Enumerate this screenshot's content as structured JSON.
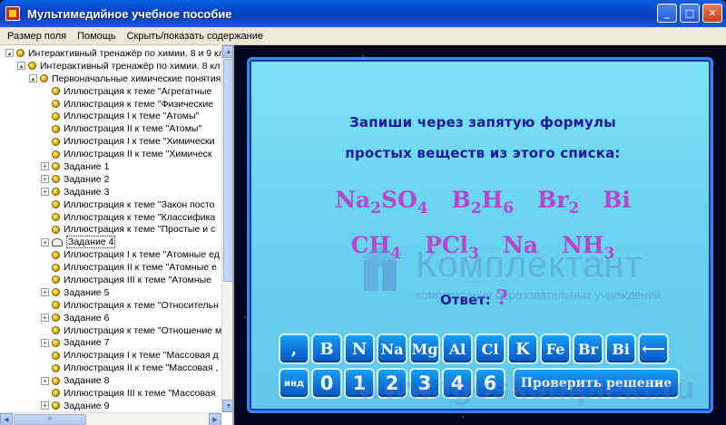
{
  "window": {
    "title": "Мультимедийное учебное пособие",
    "controls": {
      "minimize": "_",
      "maximize": "□",
      "close": "✕"
    }
  },
  "menu": {
    "items": [
      "Размер поля",
      "Помощь",
      "Скрыть/показать содержание"
    ]
  },
  "tree": {
    "items": [
      {
        "level": 0,
        "expander": "open",
        "label": "Интерактивный тренажёр по химии. 8 и 9 кл"
      },
      {
        "level": 1,
        "expander": "open",
        "label": "Интерактивный тренажёр по химии. 8 кл"
      },
      {
        "level": 2,
        "expander": "open",
        "label": "Первоначальные химические понятия"
      },
      {
        "level": 3,
        "expander": "none",
        "label": "Иллюстрация к теме \"Агрегатные"
      },
      {
        "level": 3,
        "expander": "none",
        "label": "Иллюстрация к теме \"Физические"
      },
      {
        "level": 3,
        "expander": "none",
        "label": "Иллюстрация I к теме \"Атомы\""
      },
      {
        "level": 3,
        "expander": "none",
        "label": "Иллюстрация II к теме \"Атомы\""
      },
      {
        "level": 3,
        "expander": "none",
        "label": "Иллюстрация I к теме \"Химически"
      },
      {
        "level": 3,
        "expander": "none",
        "label": "Иллюстрация II к теме \"Химическ"
      },
      {
        "level": 3,
        "expander": "closed",
        "label": "Задание 1"
      },
      {
        "level": 3,
        "expander": "closed",
        "label": "Задание 2"
      },
      {
        "level": 3,
        "expander": "closed",
        "label": "Задание 3"
      },
      {
        "level": 3,
        "expander": "none",
        "label": "Иллюстрация к теме \"Закон посто"
      },
      {
        "level": 3,
        "expander": "none",
        "label": "Иллюстрация к теме \"Классифика"
      },
      {
        "level": 3,
        "expander": "none",
        "label": "Иллюстрация к теме \"Простые и с"
      },
      {
        "level": 3,
        "expander": "closed",
        "label": "Задание 4",
        "selected": true,
        "icon": "open-book"
      },
      {
        "level": 3,
        "expander": "none",
        "label": "Иллюстрация I к теме \"Атомные ед"
      },
      {
        "level": 3,
        "expander": "none",
        "label": "Иллюстрация II к теме \"Атомные е"
      },
      {
        "level": 3,
        "expander": "none",
        "label": "Иллюстрация III к теме \"Атомные"
      },
      {
        "level": 3,
        "expander": "closed",
        "label": "Задание 5"
      },
      {
        "level": 3,
        "expander": "none",
        "label": "Иллюстрация к теме \"Относительн"
      },
      {
        "level": 3,
        "expander": "closed",
        "label": "Задание 6"
      },
      {
        "level": 3,
        "expander": "none",
        "label": "Иллюстрация к теме \"Отношение м"
      },
      {
        "level": 3,
        "expander": "closed",
        "label": "Задание 7"
      },
      {
        "level": 3,
        "expander": "none",
        "label": "Иллюстрация I к теме \"Массовая д"
      },
      {
        "level": 3,
        "expander": "none",
        "label": "Иллюстрация II к теме \"Массовая ,"
      },
      {
        "level": 3,
        "expander": "closed",
        "label": "Задание 8"
      },
      {
        "level": 3,
        "expander": "none",
        "label": "Иллюстрация III к теме \"Массовая"
      },
      {
        "level": 3,
        "expander": "closed",
        "label": "Задание 9"
      }
    ],
    "hscroll_grip": "III"
  },
  "task": {
    "line1": "Запиши через запятую формулы",
    "line2": "простых веществ из этого списка:",
    "formulas_row1": [
      {
        "parts": [
          [
            "Na",
            ""
          ],
          [
            "2",
            "sub"
          ],
          [
            "SO",
            ""
          ],
          [
            "4",
            "sub"
          ]
        ]
      },
      {
        "parts": [
          [
            "B",
            ""
          ],
          [
            "2",
            "sub"
          ],
          [
            "H",
            ""
          ],
          [
            "6",
            "sub"
          ]
        ]
      },
      {
        "parts": [
          [
            "Br",
            ""
          ],
          [
            "2",
            "sub"
          ]
        ]
      },
      {
        "parts": [
          [
            "Bi",
            ""
          ]
        ]
      }
    ],
    "formulas_row2": [
      {
        "parts": [
          [
            "CH",
            ""
          ],
          [
            "4",
            "sub"
          ]
        ]
      },
      {
        "parts": [
          [
            "PCl",
            ""
          ],
          [
            "3",
            "sub"
          ]
        ]
      },
      {
        "parts": [
          [
            "Na",
            ""
          ]
        ]
      },
      {
        "parts": [
          [
            "NH",
            ""
          ],
          [
            "3",
            "sub"
          ]
        ]
      }
    ],
    "answer_label": "Ответ:",
    "answer_value": "?"
  },
  "keypad": {
    "row1": [
      ",",
      "B",
      "N",
      "Na",
      "Mg",
      "Al",
      "Cl",
      "K",
      "Fe",
      "Br",
      "Bi",
      "⟵"
    ],
    "row2": [
      "инд",
      "0",
      "1",
      "2",
      "3",
      "4",
      "6"
    ],
    "check_button": "Проверить решение"
  },
  "watermark": {
    "name": "Комплектант",
    "tagline": "комплектация образовательных учреждений",
    "url": "www.fgoskomplekt.ru"
  },
  "colors": {
    "title_bar": "#0a5fe0",
    "card_bg": "#7ee2f6",
    "task_text": "#1a1a9a",
    "formula_text": "#b846c8",
    "key_bg": "#0a6fd8"
  }
}
